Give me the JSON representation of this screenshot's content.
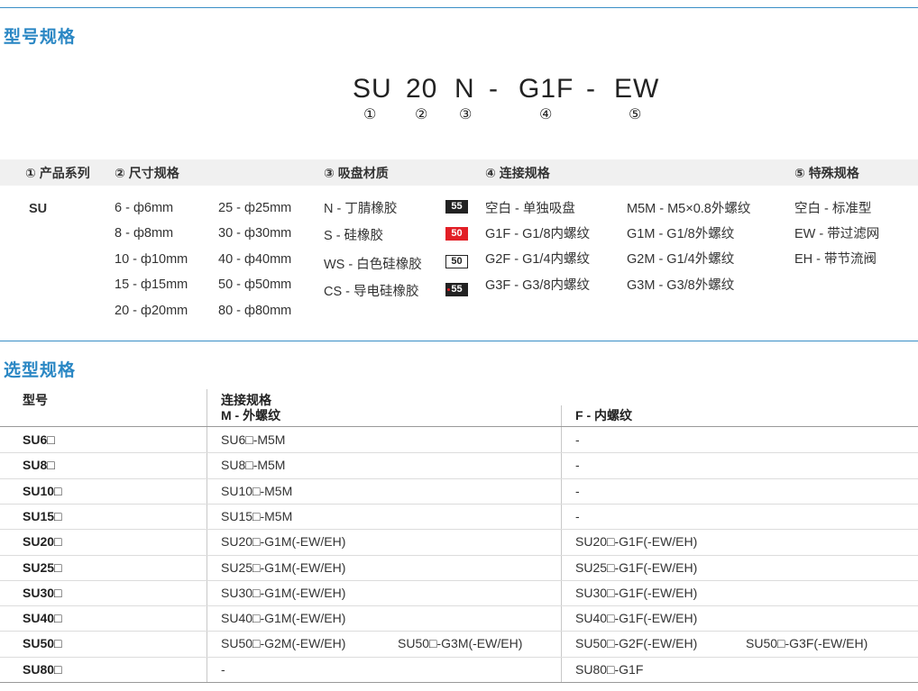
{
  "section1": {
    "title": "型号规格"
  },
  "model_code": {
    "parts": [
      "SU",
      "20",
      "N",
      "-",
      "G1F",
      "-",
      "EW"
    ],
    "markers": [
      "①",
      "②",
      "③",
      "④",
      "⑤"
    ]
  },
  "spec_headers": [
    "① 产品系列",
    "② 尺寸规格",
    "③ 吸盘材质",
    "④ 连接规格",
    "⑤ 特殊规格"
  ],
  "series": "SU",
  "sizes_left": [
    "6 - ф6mm",
    "8 - ф8mm",
    "10 - ф10mm",
    "15 - ф15mm",
    "20 - ф20mm"
  ],
  "sizes_right": [
    "25 - ф25mm",
    "30 - ф30mm",
    "40 - ф40mm",
    "50 - ф50mm",
    "80 - ф80mm"
  ],
  "materials": [
    {
      "label": "N - 丁腈橡胶",
      "badge": "55",
      "badge_style": "black"
    },
    {
      "label": "S - 硅橡胶",
      "badge": "50",
      "badge_style": "red"
    },
    {
      "label": "WS - 白色硅橡胶",
      "badge": "50",
      "badge_style": "white"
    },
    {
      "label": "CS - 导电硅橡胶",
      "badge": "55",
      "badge_style": "black-dot"
    }
  ],
  "connections_left": [
    "空白 - 单独吸盘",
    "G1F - G1/8内螺纹",
    "G2F - G1/4内螺纹",
    "G3F - G3/8内螺纹"
  ],
  "connections_right": [
    "M5M - M5×0.8外螺纹",
    "G1M - G1/8外螺纹",
    "G2M - G1/4外螺纹",
    "G3M - G3/8外螺纹"
  ],
  "special": [
    "空白 - 标准型",
    "EW - 带过滤网",
    "EH - 带节流阀"
  ],
  "section2": {
    "title": "选型规格"
  },
  "table": {
    "col_model": "型号",
    "col_conn": "连接规格",
    "col_m": "M - 外螺纹",
    "col_f": "F - 内螺纹",
    "rows": [
      {
        "model": "SU6□",
        "m": "SU6□-M5M",
        "m2": "",
        "f": "-",
        "f2": ""
      },
      {
        "model": "SU8□",
        "m": "SU8□-M5M",
        "m2": "",
        "f": "-",
        "f2": ""
      },
      {
        "model": "SU10□",
        "m": "SU10□-M5M",
        "m2": "",
        "f": "-",
        "f2": ""
      },
      {
        "model": "SU15□",
        "m": "SU15□-M5M",
        "m2": "",
        "f": "-",
        "f2": ""
      },
      {
        "model": "SU20□",
        "m": "SU20□-G1M(-EW/EH)",
        "m2": "",
        "f": "SU20□-G1F(-EW/EH)",
        "f2": ""
      },
      {
        "model": "SU25□",
        "m": "SU25□-G1M(-EW/EH)",
        "m2": "",
        "f": "SU25□-G1F(-EW/EH)",
        "f2": ""
      },
      {
        "model": "SU30□",
        "m": "SU30□-G1M(-EW/EH)",
        "m2": "",
        "f": "SU30□-G1F(-EW/EH)",
        "f2": ""
      },
      {
        "model": "SU40□",
        "m": "SU40□-G1M(-EW/EH)",
        "m2": "",
        "f": "SU40□-G1F(-EW/EH)",
        "f2": ""
      },
      {
        "model": "SU50□",
        "m": "SU50□-G2M(-EW/EH)",
        "m2": "SU50□-G3M(-EW/EH)",
        "f": "SU50□-G2F(-EW/EH)",
        "f2": "SU50□-G3F(-EW/EH)"
      },
      {
        "model": "SU80□",
        "m": "-",
        "m2": "",
        "f": "SU80□-G1F",
        "f2": ""
      }
    ]
  }
}
